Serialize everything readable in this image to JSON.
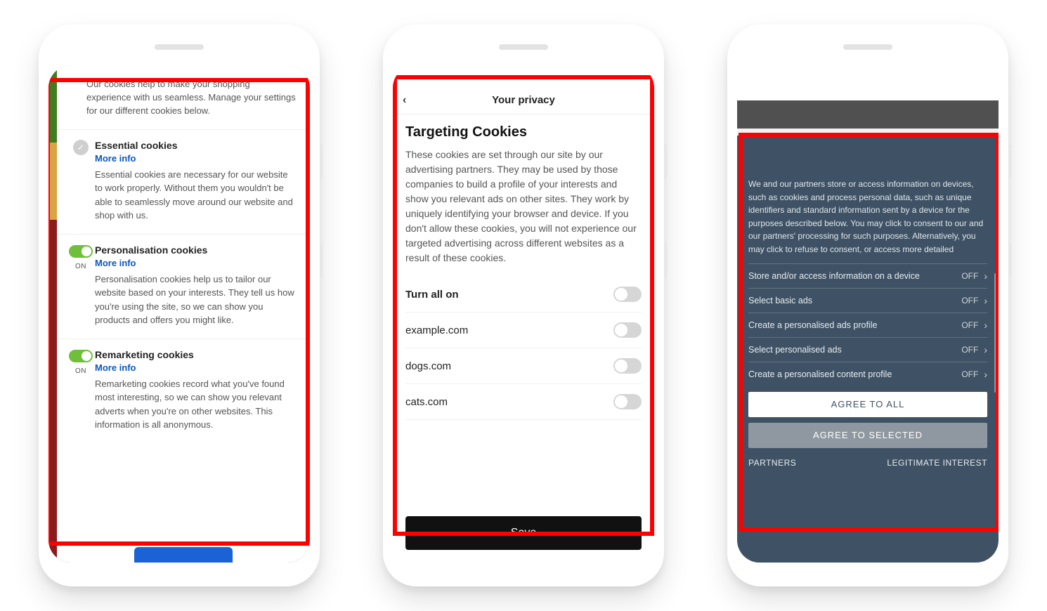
{
  "phone1": {
    "intro": "Our cookies help to make your shopping experience with us seamless. Manage your settings for our different cookies below.",
    "more_info_label": "More info",
    "on_label": "ON",
    "sections": [
      {
        "title": "Essential cookies",
        "desc": "Essential cookies are necessary for our website to work properly. Without them you wouldn't be able to seamlessly move around our website and shop with us."
      },
      {
        "title": "Personalisation cookies",
        "desc": "Personalisation cookies help us to tailor our website based on your interests. They tell us how you're using the site, so we can show you products and offers you might like."
      },
      {
        "title": "Remarketing cookies",
        "desc": "Remarketing cookies record what you've found most interesting, so we can show you relevant adverts when you're on other websites. This information is all anonymous."
      }
    ]
  },
  "phone2": {
    "header": "Your privacy",
    "title": "Targeting Cookies",
    "desc": "These cookies are set through our site by our advertising partners. They may be used by those companies to build a profile of your interests and show you relevant ads on other sites. They work by uniquely identifying your browser and device. If you don't allow these cookies, you will not experience our targeted advertising across different websites as a result of these cookies.",
    "turn_all": "Turn all on",
    "items": [
      "example.com",
      "dogs.com",
      "cats.com"
    ],
    "save": "Save"
  },
  "phone3": {
    "intro": "We and our partners store or access information on devices, such as cookies and process personal data, such as unique identifiers and standard information sent by a device for the purposes described below. You may click to consent to our and our partners' processing for such purposes. Alternatively, you may click to refuse to consent, or access more detailed",
    "off_label": "OFF",
    "rows": [
      "Store and/or access information on a device",
      "Select basic ads",
      "Create a personalised ads profile",
      "Select personalised ads",
      "Create a personalised content profile"
    ],
    "agree_all": "AGREE TO ALL",
    "agree_selected": "AGREE TO SELECTED",
    "partners": "PARTNERS",
    "legitimate": "LEGITIMATE INTEREST"
  }
}
